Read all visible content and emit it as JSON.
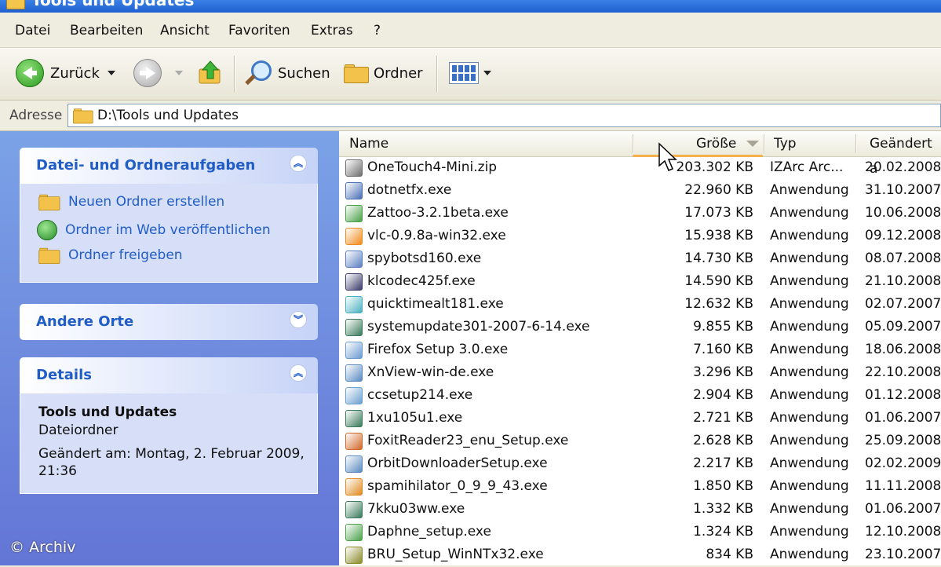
{
  "window": {
    "title": "Tools und Updates"
  },
  "menubar": {
    "items": [
      "Datei",
      "Bearbeiten",
      "Ansicht",
      "Favoriten",
      "Extras",
      "?"
    ]
  },
  "toolbar": {
    "back_label": "Zurück",
    "search_label": "Suchen",
    "folders_label": "Ordner"
  },
  "address": {
    "label": "Adresse",
    "path": "D:\\Tools und Updates"
  },
  "taskpane": {
    "file_tasks": {
      "title": "Datei- und Ordneraufgaben",
      "items": [
        "Neuen Ordner erstellen",
        "Ordner im Web veröffentlichen",
        "Ordner freigeben"
      ]
    },
    "other_places": {
      "title": "Andere Orte"
    },
    "details": {
      "title": "Details",
      "name": "Tools und Updates",
      "kind": "Dateiordner",
      "modified_line1": "Geändert am: Montag, 2. Februar 2009,",
      "modified_line2": "21:36"
    }
  },
  "filelist": {
    "columns": [
      "Name",
      "Größe",
      "Typ",
      "Geändert a"
    ],
    "sort_column": "Größe",
    "rows": [
      {
        "name": "OneTouch4-Mini.zip",
        "size": "203.302 KB",
        "type": "IZArc Arc...",
        "date": "20.02.2008",
        "icon": "zip-archive-icon",
        "color": "#6d6d6d"
      },
      {
        "name": "dotnetfx.exe",
        "size": "22.960 KB",
        "type": "Anwendung",
        "date": "31.10.2007",
        "icon": "installer-icon",
        "color": "#4a6fb5"
      },
      {
        "name": "Zattoo-3.2.1beta.exe",
        "size": "17.073 KB",
        "type": "Anwendung",
        "date": "10.06.2008",
        "icon": "setup-icon",
        "color": "#4aa14a"
      },
      {
        "name": "vlc-0.9.8a-win32.exe",
        "size": "15.938 KB",
        "type": "Anwendung",
        "date": "09.12.2008",
        "icon": "vlc-cone-icon",
        "color": "#f08a1a"
      },
      {
        "name": "spybotsd160.exe",
        "size": "14.730 KB",
        "type": "Anwendung",
        "date": "08.07.2008",
        "icon": "spybot-icon",
        "color": "#5a7fc0"
      },
      {
        "name": "klcodec425f.exe",
        "size": "14.590 KB",
        "type": "Anwendung",
        "date": "21.10.2008",
        "icon": "codec-icon",
        "color": "#3b3b6b"
      },
      {
        "name": "quicktimealt181.exe",
        "size": "12.632 KB",
        "type": "Anwendung",
        "date": "02.07.2007",
        "icon": "quicktime-icon",
        "color": "#4ab0c0"
      },
      {
        "name": "systemupdate301-2007-6-14.exe",
        "size": "9.855 KB",
        "type": "Anwendung",
        "date": "05.09.2007",
        "icon": "installer-icon",
        "color": "#3a7a5a"
      },
      {
        "name": "Firefox Setup 3.0.exe",
        "size": "7.160 KB",
        "type": "Anwendung",
        "date": "18.06.2008",
        "icon": "setup-icon",
        "color": "#6a9ad0"
      },
      {
        "name": "XnView-win-de.exe",
        "size": "3.296 KB",
        "type": "Anwendung",
        "date": "22.10.2008",
        "icon": "installer-icon",
        "color": "#5a8ac0"
      },
      {
        "name": "ccsetup214.exe",
        "size": "2.904 KB",
        "type": "Anwendung",
        "date": "01.12.2008",
        "icon": "setup-icon",
        "color": "#6aa0d0"
      },
      {
        "name": "1xu105u1.exe",
        "size": "2.721 KB",
        "type": "Anwendung",
        "date": "01.06.2007",
        "icon": "installer-icon",
        "color": "#3a7a5a"
      },
      {
        "name": "FoxitReader23_enu_Setup.exe",
        "size": "2.628 KB",
        "type": "Anwendung",
        "date": "25.09.2008",
        "icon": "foxit-icon",
        "color": "#d0682a"
      },
      {
        "name": "OrbitDownloaderSetup.exe",
        "size": "2.217 KB",
        "type": "Anwendung",
        "date": "02.02.2009",
        "icon": "installer-icon",
        "color": "#5a8ac0"
      },
      {
        "name": "spamihilator_0_9_9_43.exe",
        "size": "1.850 KB",
        "type": "Anwendung",
        "date": "11.11.2008",
        "icon": "spamihilator-icon",
        "color": "#e08a20"
      },
      {
        "name": "7kku03ww.exe",
        "size": "1.332 KB",
        "type": "Anwendung",
        "date": "01.06.2007",
        "icon": "installer-icon",
        "color": "#3a7a5a"
      },
      {
        "name": "Daphne_setup.exe",
        "size": "1.324 KB",
        "type": "Anwendung",
        "date": "12.10.2008",
        "icon": "setup-icon",
        "color": "#4aa14a"
      },
      {
        "name": "BRU_Setup_WinNTx32.exe",
        "size": "834 KB",
        "type": "Anwendung",
        "date": "23.10.2007",
        "icon": "bru-icon",
        "color": "#8a8a2a"
      }
    ]
  },
  "credit": "© Archiv"
}
